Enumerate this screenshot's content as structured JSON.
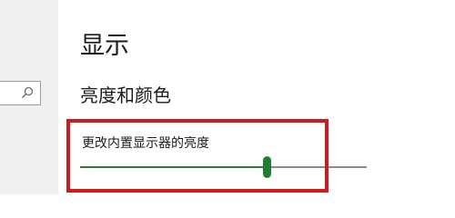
{
  "sidebar": {
    "search": {
      "icon": "search-icon"
    }
  },
  "main": {
    "title": "显示",
    "section_heading": "亮度和颜色",
    "brightness": {
      "label": "更改内置显示器的亮度",
      "value_fraction": 0.65,
      "accent_color": "#217d2f"
    }
  },
  "annotation": {
    "highlight_color": "#d3181e"
  }
}
